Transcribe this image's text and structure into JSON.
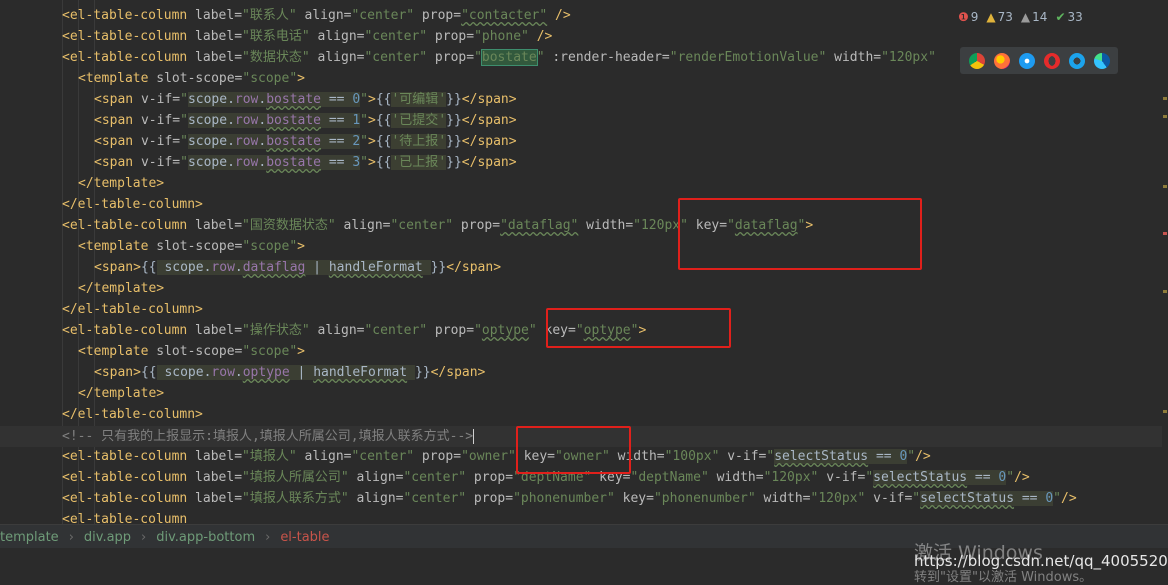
{
  "code": {
    "l1": {
      "tag": "<el-table-column",
      "label_attr": " label=",
      "label_val": "\"联系人\"",
      "align_attr": " align=",
      "align_val": "\"center\"",
      "prop_attr": " prop=",
      "prop_val": "\"contacter\"",
      "end": " />"
    },
    "l2": {
      "tag": "<el-table-column",
      "label_attr": " label=",
      "label_val": "\"联系电话\"",
      "align_attr": " align=",
      "align_val": "\"center\"",
      "prop_attr": " prop=",
      "prop_val": "\"phone\"",
      "end": " />"
    },
    "l3": {
      "tag": "<el-table-column",
      "label_attr": " label=",
      "label_val": "\"数据状态\"",
      "align_attr": " align=",
      "align_val": "\"center\"",
      "prop_attr": " prop=",
      "prop_q1": "\"",
      "prop_word": "bostate",
      "prop_q2": "\"",
      "rh_attr": " :render-header=",
      "rh_val": "\"renderEmotionValue\"",
      "width_attr": " width=",
      "width_val": "\"120px\""
    },
    "template_open": "<template",
    "slot_scope_attr": " slot-scope=",
    "slot_scope_val": "\"scope\"",
    "gt": ">",
    "span_rows": [
      {
        "num": "0",
        "text": "可编辑"
      },
      {
        "num": "1",
        "text": "已提交"
      },
      {
        "num": "2",
        "text": "待上报"
      },
      {
        "num": "3",
        "text": "已上报"
      }
    ],
    "span_open": "<span",
    "vif_attr": " v-if=",
    "scope_word": "scope",
    "dot": ".",
    "row_word": "row",
    "bostate_word": "bostate",
    "eq": " == ",
    "mustache_open": "{{",
    "mustache_close": "}}",
    "span_close": "</span>",
    "template_close": "</template>",
    "column_close": "</el-table-column>",
    "l10": {
      "label_val": "\"国资数据状态\"",
      "prop_val": "\"dataflag\"",
      "width_val": "\"120px\"",
      "key_attr": " key=",
      "key_q": "\"",
      "key_word": "dataflag"
    },
    "dataflag_word": "dataflag",
    "handle_word": "handleFormat",
    "pipe": " | ",
    "l15": {
      "label_val": "\"操作状态\"",
      "prop_word": "optype",
      "key_word": "optype"
    },
    "optype_word": "optype",
    "comment": "<!-- 只有我的上报显示:填报人,填报人所属公司,填报人联系方式-->",
    "l21": {
      "label_val": "\"填报人\"",
      "prop_val": "\"owner\"",
      "key_val": "\"owner\"",
      "width_val": "\"100px\""
    },
    "l22": {
      "label_val": "\"填报人所属公司\"",
      "prop_val": "\"deptName\"",
      "key_val": "\"deptName\"",
      "width_val": "\"120px\""
    },
    "l23": {
      "label_val": "\"填报人联系方式\"",
      "prop_val": "\"phonenumber\"",
      "key_val": "\"phonenumber\"",
      "width_val": "\"120px\""
    },
    "select_status": "selectStatus",
    "zero": "0",
    "l24": "<el-table-column"
  },
  "inspections": {
    "errors": "9",
    "warnings": "73",
    "weak": "14",
    "ok": "33"
  },
  "breadcrumb": [
    "template",
    "div.app",
    "div.app-bottom",
    "el-table"
  ],
  "overlay": {
    "watermark_title": "激活 Windows",
    "watermark_sub": "转到\"设置\"以激活 Windows。",
    "blog_url": "https://blog.csdn.net/qq_4005520"
  }
}
